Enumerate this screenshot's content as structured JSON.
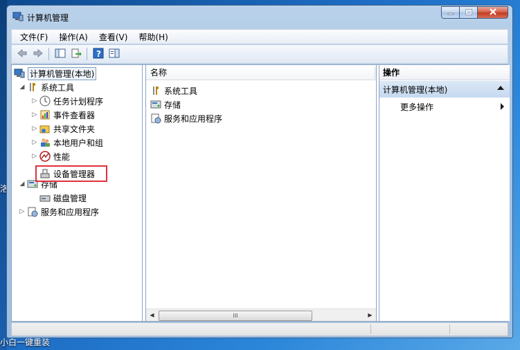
{
  "window": {
    "title": "计算机管理"
  },
  "menu": [
    {
      "label": "文件(F)"
    },
    {
      "label": "操作(A)"
    },
    {
      "label": "查看(V)"
    },
    {
      "label": "帮助(H)"
    }
  ],
  "tree": {
    "root": "计算机管理(本地)",
    "system_tools": "系统工具",
    "task_scheduler": "任务计划程序",
    "event_viewer": "事件查看器",
    "shared_folders": "共享文件夹",
    "local_users": "本地用户和组",
    "performance": "性能",
    "device_manager": "设备管理器",
    "storage": "存储",
    "disk_management": "磁盘管理",
    "services_apps": "服务和应用程序"
  },
  "middle": {
    "column_name": "名称",
    "items": [
      "系统工具",
      "存储",
      "服务和应用程序"
    ],
    "scroll_grip": "III"
  },
  "actions": {
    "header": "操作",
    "group": "计算机管理(本地)",
    "more": "更多操作"
  },
  "desktop": {
    "left_edge_text": "洛",
    "bottom_text": "小白一键重装"
  }
}
